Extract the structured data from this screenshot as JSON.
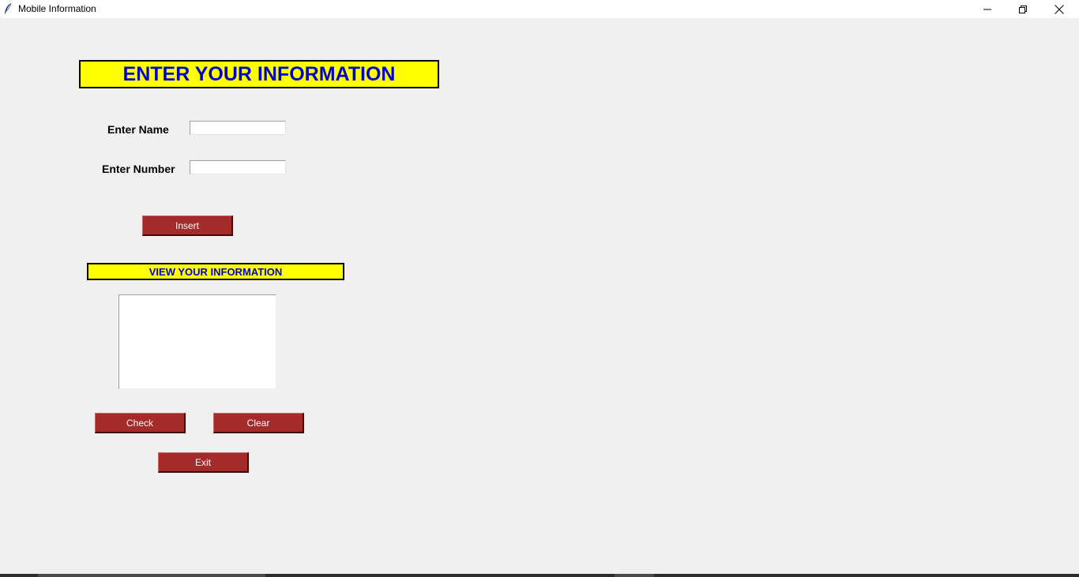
{
  "window": {
    "title": "Mobile Information",
    "icon": "feather-icon",
    "controls": [
      "minimize-icon",
      "restore-icon",
      "close-icon"
    ]
  },
  "form": {
    "heading": "ENTER YOUR INFORMATION",
    "name_label": "Enter Name",
    "name_value": "",
    "number_label": "Enter Number",
    "number_value": "",
    "insert_label": "Insert"
  },
  "view": {
    "heading": "VIEW YOUR INFORMATION",
    "content": "",
    "check_label": "Check",
    "clear_label": "Clear",
    "exit_label": "Exit"
  },
  "colors": {
    "heading_bg": "#ffff00",
    "heading_text": "#0000cd",
    "button_bg": "#a52a2a",
    "button_text": "#ffffff",
    "window_bg": "#f0f0f0"
  }
}
